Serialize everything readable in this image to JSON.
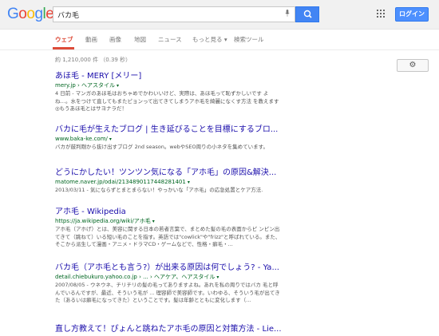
{
  "header": {
    "logo": [
      "G",
      "o",
      "o",
      "g",
      "l",
      "e"
    ],
    "logo_colors": [
      "#4285f4",
      "#ea4335",
      "#fbbc05",
      "#4285f4",
      "#34a853",
      "#ea4335"
    ],
    "query": "バカ毛",
    "login_label": "ログイン"
  },
  "tabs": [
    {
      "label": "ウェブ",
      "active": true
    },
    {
      "label": "動画"
    },
    {
      "label": "画像"
    },
    {
      "label": "地図"
    },
    {
      "label": "ニュース"
    },
    {
      "label": "もっと見る ▾"
    },
    {
      "label": "検索ツール"
    }
  ],
  "stats": "約 1,210,000 件 （0.39 秒）",
  "results": [
    {
      "title": "あほ毛 - MERY [メリー]",
      "url": "mery.jp › ヘアスタイル",
      "snippet": [
        "4 日前 - マンガのあほ毛はおちゃめでかわいいけど、実際は、あほ毛って恥ずかしいです よね…。水をつけて直してもまたピョンって出てきてしまうアホ毛を綺麗になくす方法 を教えます◎もうあほ毛とはサヨナラだ！"
      ]
    },
    {
      "title": "バカに毛が生えたブログ | 生き延びることを目標にするブロ...",
      "url": "www.baka-ke.com/",
      "snippet": [
        "バカが鼓判剛から抜け出すブログ 2nd season。webやSEO周りの小ネタを集めています。"
      ]
    },
    {
      "title": "どうにかしたい！ツンツン気になる「アホ毛」の原因&解決...",
      "url": "matome.naver.jp/odai/2134890117448281401",
      "snippet": [
        "2013/03/11 - 気にならずとまとまらない！やっかいな「アホ毛」の応急処置とケア方法."
      ]
    },
    {
      "title": "アホ毛 - Wikipedia",
      "url": "https://ja.wikipedia.org/wiki/アホ毛",
      "snippet": [
        "アホ毛（アホげ）とは、美容に関する日本の若者言葉で、まとめた髪の毛の表面からピ ンピン出てきて（跳ねて）いる短い毛のことを指す。英語では\"cowlick\"や\"frizz\"と呼ばれている。また、そこから派生して漫画・アニメ・ドラマCD・ゲームなどで、性格・癖毛・..."
      ]
    },
    {
      "title": "バカ毛（アホ毛とも言う?）が出来る原因は何でしょう? - Ya...",
      "url": "detail.chiebukuro.yahoo.co.jp › ... › ヘアケア、ヘアスタイル",
      "snippet": [
        "2007/08/05 - ウネウネ、チリチリの髪の毛ってありますよね。あれを私の周りではバカ 毛と呼んでいるんですが、最近、そういう毛が ... 理容師で美容師です。いわゆる、そういう毛が出てきた（あるいは癖毛になってきた）ということです。髪は年齢とともに変化します（..."
      ]
    },
    {
      "title": "直し方教えて！ぴょんと跳ねたアホ毛の原因と対策方法 - Lie...",
      "url": "",
      "snippet": []
    }
  ]
}
